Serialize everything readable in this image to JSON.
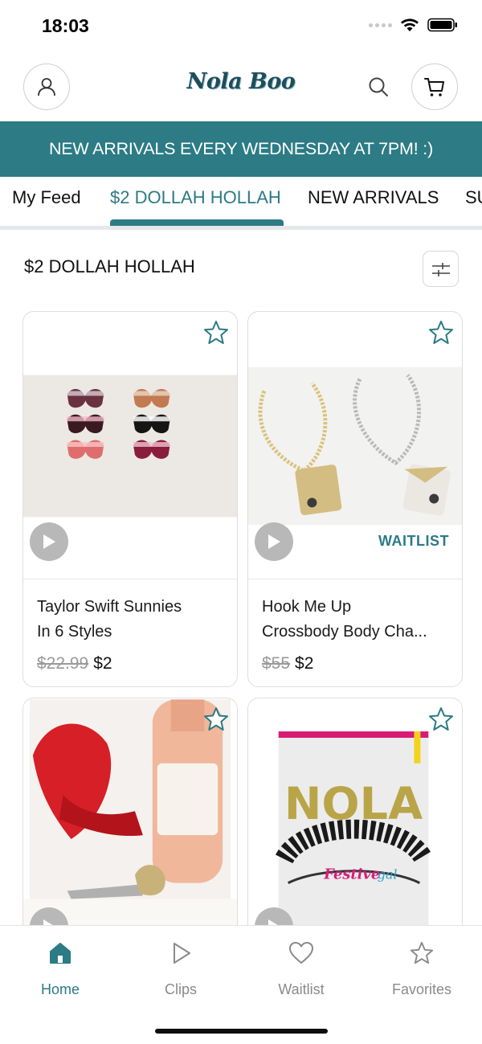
{
  "status_bar": {
    "time": "18:03"
  },
  "header": {
    "logo_text": "Nola Boo"
  },
  "banner": {
    "text": "NEW ARRIVALS EVERY WEDNESDAY AT 7PM! :)"
  },
  "tabs": [
    {
      "label": "My Feed"
    },
    {
      "label": "$2 DOLLAH HOLLAH"
    },
    {
      "label": "NEW ARRIVALS"
    },
    {
      "label": "SU"
    }
  ],
  "section": {
    "title": "$2 DOLLAH HOLLAH"
  },
  "products": [
    {
      "title_line1": "Taylor Swift Sunnies",
      "title_line2": "In 6 Styles",
      "old_price": "$22.99",
      "price": "$2",
      "badge": ""
    },
    {
      "title_line1": "Hook Me Up",
      "title_line2": "Crossbody Body Cha...",
      "old_price": "$55",
      "price": "$2",
      "badge": "WAITLIST"
    },
    {
      "title_line1": "",
      "title_line2": "",
      "old_price": "",
      "price": "",
      "badge": ""
    },
    {
      "title_line1": "",
      "title_line2": "",
      "old_price": "",
      "price": "",
      "badge": ""
    }
  ],
  "bottom_nav": [
    {
      "label": "Home",
      "icon": "home-icon"
    },
    {
      "label": "Clips",
      "icon": "play-icon"
    },
    {
      "label": "Waitlist",
      "icon": "heart-icon"
    },
    {
      "label": "Favorites",
      "icon": "star-icon"
    }
  ],
  "colors": {
    "accent": "#2c7b85",
    "banner": "#2c7b85",
    "muted": "#8a8a8a"
  }
}
